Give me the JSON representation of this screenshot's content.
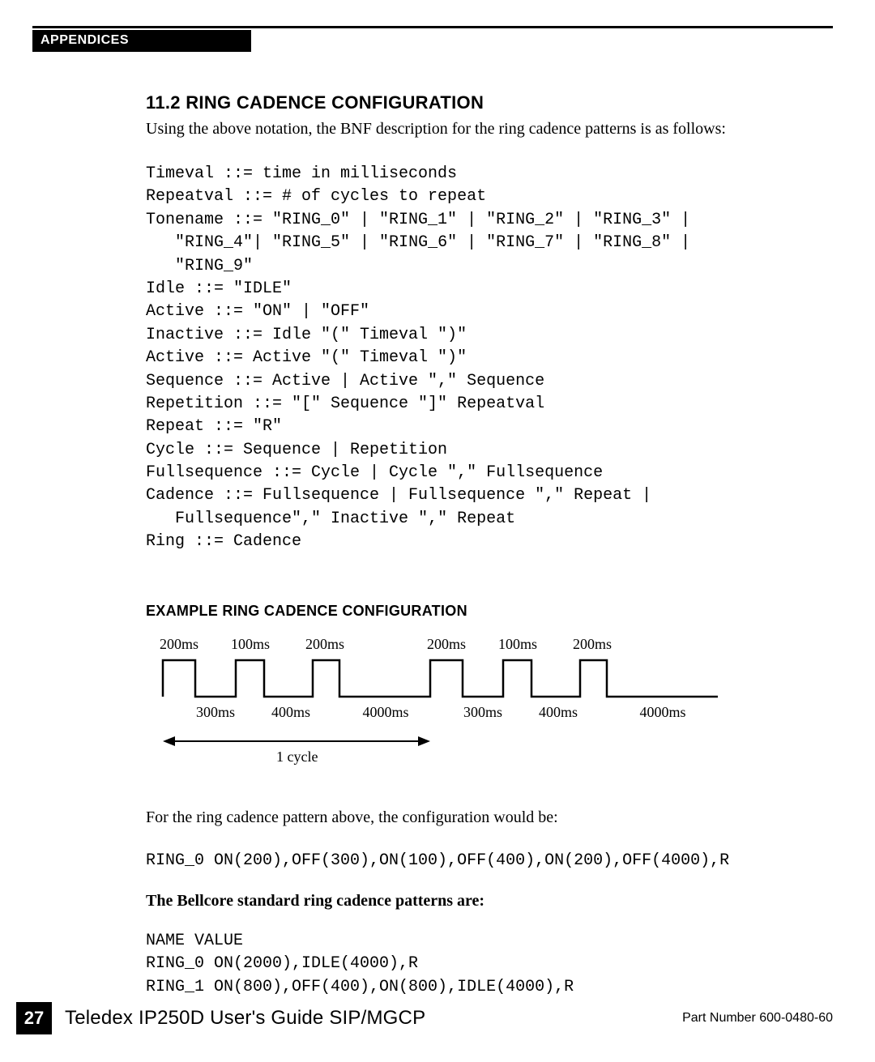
{
  "header": {
    "tab": "APPENDICES"
  },
  "section": {
    "number_title": "11.2 RING CADENCE CONFIGURATION",
    "intro": "Using the above notation, the BNF description for the ring cadence patterns is as follows:"
  },
  "bnf": "Timeval ::= time in milliseconds\nRepeatval ::= # of cycles to repeat\nTonename ::= \"RING_0\" | \"RING_1\" | \"RING_2\" | \"RING_3\" |\n   \"RING_4\"| \"RING_5\" | \"RING_6\" | \"RING_7\" | \"RING_8\" |\n   \"RING_9\"\nIdle ::= \"IDLE\"\nActive ::= \"ON\" | \"OFF\"\nInactive ::= Idle \"(\" Timeval \")\"\nActive ::= Active \"(\" Timeval \")\"\nSequence ::= Active | Active \",\" Sequence\nRepetition ::= \"[\" Sequence \"]\" Repeatval\nRepeat ::= \"R\"\nCycle ::= Sequence | Repetition\nFullsequence ::= Cycle | Cycle \",\" Fullsequence\nCadence ::= Fullsequence | Fullsequence \",\" Repeat |\n   Fullsequence\",\" Inactive \",\" Repeat\nRing ::= Cadence",
  "example": {
    "title": "EXAMPLE RING CADENCE CONFIGURATION",
    "labels_top": [
      "200ms",
      "100ms",
      "200ms",
      "200ms",
      "100ms",
      "200ms"
    ],
    "labels_bottom": [
      "300ms",
      "400ms",
      "4000ms",
      "300ms",
      "400ms",
      "4000ms"
    ],
    "cycle_label": "1 cycle",
    "text_after": "For the ring cadence pattern above, the configuration would be:",
    "config_line": "RING_0 ON(200),OFF(300),ON(100),OFF(400),ON(200),OFF(4000),R"
  },
  "bellcore": {
    "heading": "The Bellcore standard ring cadence patterns are:",
    "lines": "NAME VALUE\nRING_0 ON(2000),IDLE(4000),R\nRING_1 ON(800),OFF(400),ON(800),IDLE(4000),R"
  },
  "footer": {
    "page": "27",
    "title": "Teledex IP250D User's Guide  SIP/MGCP",
    "part": "Part Number 600-0480-60"
  }
}
